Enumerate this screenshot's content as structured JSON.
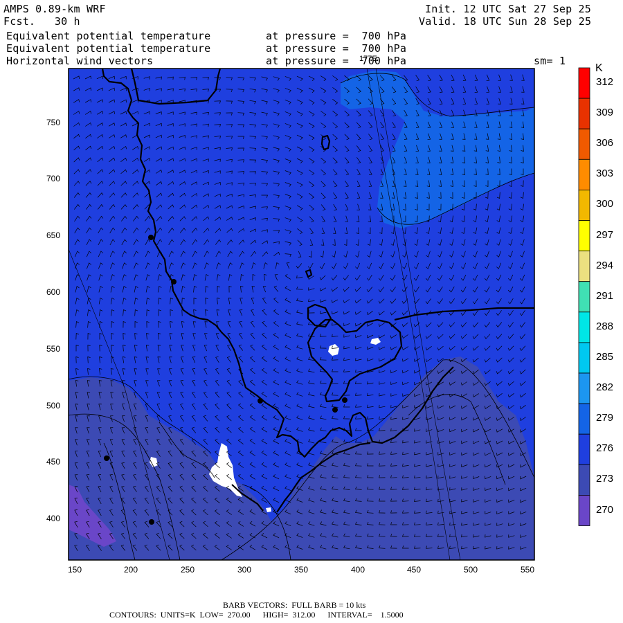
{
  "header": {
    "model": "AMPS 0.89-km WRF",
    "forecast": "Fcst.   30 h",
    "init": "Init. 12 UTC Sat 27 Sep 25",
    "valid": "Valid. 18 UTC Sun 28 Sep 25",
    "fields": [
      {
        "name": "Equivalent potential temperature",
        "level": "at pressure =  700 hPa"
      },
      {
        "name": "Equivalent potential temperature",
        "level": "at pressure =  700 hPa"
      },
      {
        "name": "Horizontal wind vectors",
        "level": "at pressure =  700 hPa"
      }
    ],
    "smoothing": "sm= 1",
    "overlap_label": "177E"
  },
  "map": {
    "x_ticks": [
      "150",
      "200",
      "250",
      "300",
      "350",
      "400",
      "450",
      "500",
      "550"
    ],
    "y_ticks": [
      "750",
      "700",
      "650",
      "600",
      "550",
      "500",
      "450",
      "400"
    ],
    "colors": {
      "background": "#1f3fdf",
      "light": "#1464e6",
      "dark": "#3c4ab4",
      "purple": "#6a46c8",
      "snow": "#ffffff",
      "coast": "#000000"
    }
  },
  "colorbar": {
    "unit": "K",
    "labels": [
      "312",
      "309",
      "306",
      "303",
      "300",
      "297",
      "294",
      "291",
      "288",
      "285",
      "282",
      "279",
      "276",
      "273",
      "270"
    ],
    "colors": [
      "#ff0000",
      "#e83200",
      "#f05a00",
      "#ff8c00",
      "#f2b800",
      "#ffff00",
      "#ebe080",
      "#40e0b4",
      "#00e6e6",
      "#00c8f0",
      "#1c96f0",
      "#1464e6",
      "#1f3fdf",
      "#3c4ab4",
      "#6a46c8"
    ]
  },
  "footer": {
    "barb": "BARB VECTORS:  FULL BARB = 10 kts",
    "contours": "CONTOURS:  UNITS=K  LOW=  270.00      HIGH=  312.00      INTERVAL=    1.5000"
  }
}
